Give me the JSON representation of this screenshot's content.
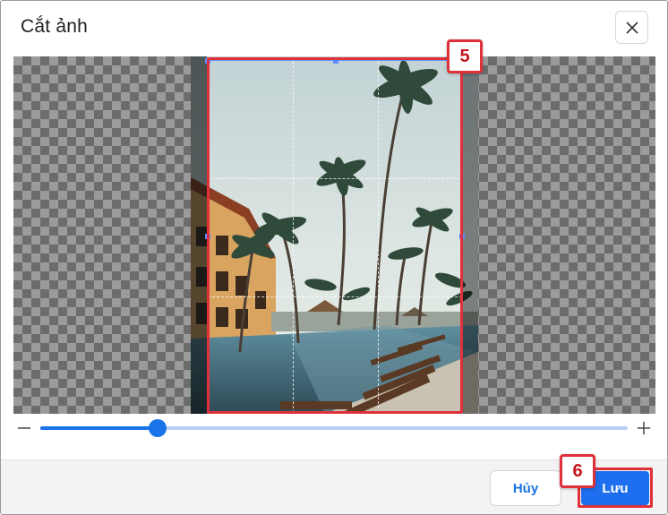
{
  "dialog": {
    "title": "Cắt ảnh",
    "close_icon": "close-icon"
  },
  "cropper": {
    "image_subject": "resort-pool-palm-trees-photo"
  },
  "zoom": {
    "minus_icon": "minus-icon",
    "plus_icon": "plus-icon",
    "level": 0.2
  },
  "footer": {
    "cancel_label": "Hủy",
    "save_label": "Lưu"
  },
  "annotations": {
    "crop_step": "5",
    "save_step": "6"
  },
  "colors": {
    "accent": "#1a73e8",
    "callout": "#e0313a"
  }
}
